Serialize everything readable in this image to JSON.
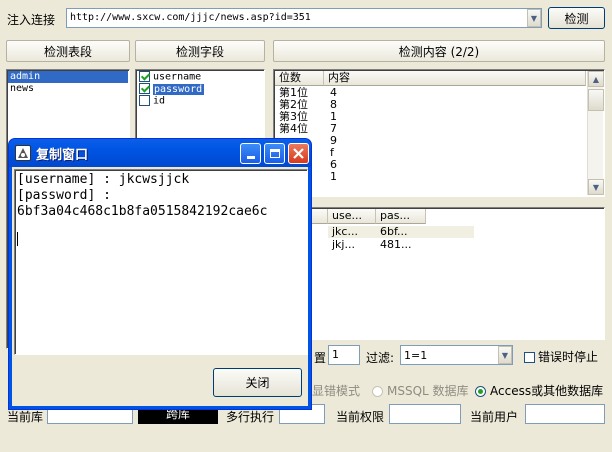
{
  "toolbar": {
    "url_label": "注入连接",
    "url_value": "http://www.sxcw.com/jjjc/news.asp?id=351",
    "detect_button": "检测"
  },
  "tables_panel": {
    "header": "检测表段",
    "items": [
      "admin",
      "news"
    ]
  },
  "fields_panel": {
    "header": "检测字段",
    "items": [
      {
        "label": "username",
        "checked": true
      },
      {
        "label": "password",
        "checked": true
      },
      {
        "label": "id",
        "checked": false
      }
    ]
  },
  "content_panel": {
    "header": "检测内容 (2/2)",
    "columns": [
      "位数",
      "内容"
    ],
    "rows": [
      [
        "第1位",
        "4"
      ],
      [
        "第2位",
        "8"
      ],
      [
        "第3位",
        "1"
      ],
      [
        "第4位",
        "7"
      ],
      [
        "",
        "9"
      ],
      [
        "",
        "f"
      ],
      [
        "",
        "6"
      ],
      [
        "",
        "1"
      ]
    ]
  },
  "results_grid": {
    "columns": [
      "use...",
      "pas..."
    ],
    "rows": [
      [
        "jkc...",
        "6bf..."
      ],
      [
        "jkj...",
        "481..."
      ]
    ]
  },
  "options": {
    "position_label": "置",
    "position_value": "1",
    "filter_label": "过滤:",
    "filter_value": "1=1",
    "stop_on_error": "错误时停止",
    "error_mode": "显错模式",
    "mssql_db": "MSSQL 数据库",
    "access_db": "Access或其他数据库"
  },
  "status_bar": {
    "current_db": "当前库",
    "cross_db": "跨库",
    "multi_exec": "多行执行",
    "current_priv": "当前权限",
    "current_user": "当前用户"
  },
  "dialog": {
    "title": "复制窗口",
    "line1": "[username] : jkcwsjjck",
    "line2": "[password] :",
    "line3": "6bf3a04c468c1b8fa0515842192cae6c",
    "close_button": "关闭"
  },
  "colors": {
    "selection": "#316ac5",
    "window_bg": "#ece9d8",
    "titlebar": "#0054e3",
    "close_red": "#e0442a"
  }
}
